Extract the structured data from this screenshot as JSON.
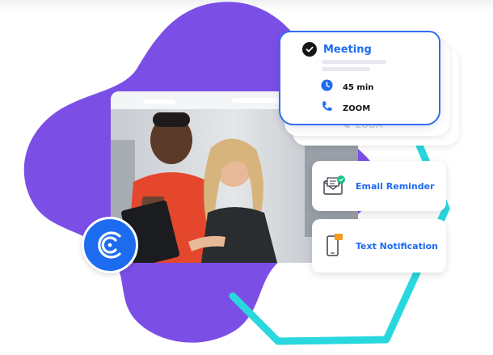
{
  "meeting": {
    "title": "Meeting",
    "duration": "45 min",
    "location": "ZOOM"
  },
  "notifications": [
    {
      "label": "Email Reminder",
      "icon": "envelope-icon"
    },
    {
      "label": "Text Notification",
      "icon": "smartphone-icon"
    }
  ],
  "ghost": {
    "location": "ZOOM"
  },
  "colors": {
    "blob": "#7b4fe6",
    "outline": "#29d7df",
    "accent_blue": "#1f6bf0",
    "badge_green": "#18c28a",
    "badge_orange": "#f39a1f",
    "brand_badge": "#1d6cf0"
  },
  "icons": {
    "brand": "brand-logo-icon",
    "check": "check-circle-icon",
    "duration": "clock-icon",
    "location": "phone-icon"
  }
}
